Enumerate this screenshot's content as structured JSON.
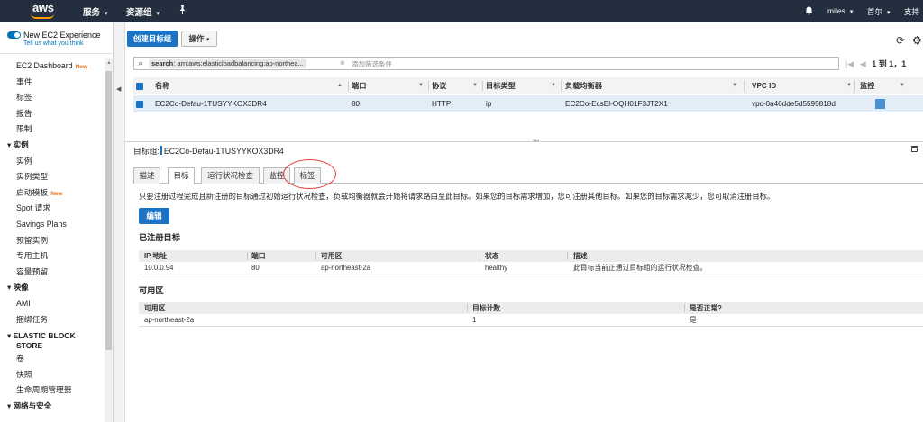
{
  "topnav": {
    "logo": "aws",
    "services": "服务",
    "resource_groups": "资源组",
    "user": "miles",
    "region": "首尔",
    "support": "支持"
  },
  "sidebar": {
    "new_exp": "New EC2 Experience",
    "tell_us": "Tell us what you think",
    "items": [
      {
        "type": "item",
        "label": "EC2 Dashboard",
        "badge": "New"
      },
      {
        "type": "item",
        "label": "事件"
      },
      {
        "type": "item",
        "label": "标签"
      },
      {
        "type": "item",
        "label": "报告"
      },
      {
        "type": "item",
        "label": "限制"
      },
      {
        "type": "section",
        "label": "实例"
      },
      {
        "type": "item",
        "label": "实例"
      },
      {
        "type": "item",
        "label": "实例类型"
      },
      {
        "type": "item",
        "label": "启动模板",
        "badge": "New"
      },
      {
        "type": "item",
        "label": "Spot 请求"
      },
      {
        "type": "item",
        "label": "Savings Plans"
      },
      {
        "type": "item",
        "label": "预留实例"
      },
      {
        "type": "item",
        "label": "专用主机"
      },
      {
        "type": "item",
        "label": "容量预留"
      },
      {
        "type": "section",
        "label": "映像"
      },
      {
        "type": "item",
        "label": "AMI"
      },
      {
        "type": "item",
        "label": "捆绑任务"
      },
      {
        "type": "section2",
        "label": "ELASTIC BLOCK",
        "label2": "STORE"
      },
      {
        "type": "item",
        "label": "卷"
      },
      {
        "type": "item",
        "label": "快照"
      },
      {
        "type": "item",
        "label": "生命周期管理器"
      },
      {
        "type": "section",
        "label": "网络与安全"
      }
    ]
  },
  "toolbar": {
    "create": "创建目标组",
    "actions": "操作"
  },
  "filter": {
    "token_key": "search",
    "token_value": ": arn:aws:elasticloadbalancing:ap-northea...",
    "placeholder": "添加筛选条件",
    "pager": "1 到 1，1"
  },
  "grid": {
    "columns": [
      "名称",
      "端口",
      "协议",
      "目标类型",
      "负载均衡器",
      "VPC ID",
      "监控"
    ],
    "row": {
      "name": "EC2Co-Defau-1TUSYYKOX3DR4",
      "port": "80",
      "protocol": "HTTP",
      "target_type": "ip",
      "lb": "EC2Co-EcsEl-OQH01F3JT2X1",
      "vpc": "vpc-0a46dde5d5595818d"
    }
  },
  "details": {
    "title_label": "目标组:",
    "title_value": "EC2Co-Defau-1TUSYYKOX3DR4",
    "tabs": [
      "描述",
      "目标",
      "运行状况检查",
      "监控",
      "标签"
    ],
    "active_tab": 1,
    "desc": "只要注册过程完成且新注册的目标通过初始运行状况检查，负载均衡器就会开始将请求路由至此目标。如果您的目标需求增加，您可注册其他目标。如果您的目标需求减少，您可取消注册目标。",
    "edit": "编辑",
    "registered_title": "已注册目标",
    "registered_cols": [
      "IP 地址",
      "端口",
      "可用区",
      "状态",
      "描述"
    ],
    "registered_row": [
      "10.0.0.94",
      "80",
      "ap-northeast-2a",
      "healthy",
      "此目标当前正通过目标组的运行状况检查。"
    ],
    "az_title": "可用区",
    "az_cols": [
      "可用区",
      "目标计数",
      "是否正常?"
    ],
    "az_row": [
      "ap-northeast-2a",
      "1",
      "是"
    ]
  },
  "colors": {
    "nav_bg": "#232f3e",
    "primary": "#1a73c5",
    "selected_row": "#e2edf7",
    "badge": "#e8711c",
    "highlight_circle": "#e23c3c"
  }
}
